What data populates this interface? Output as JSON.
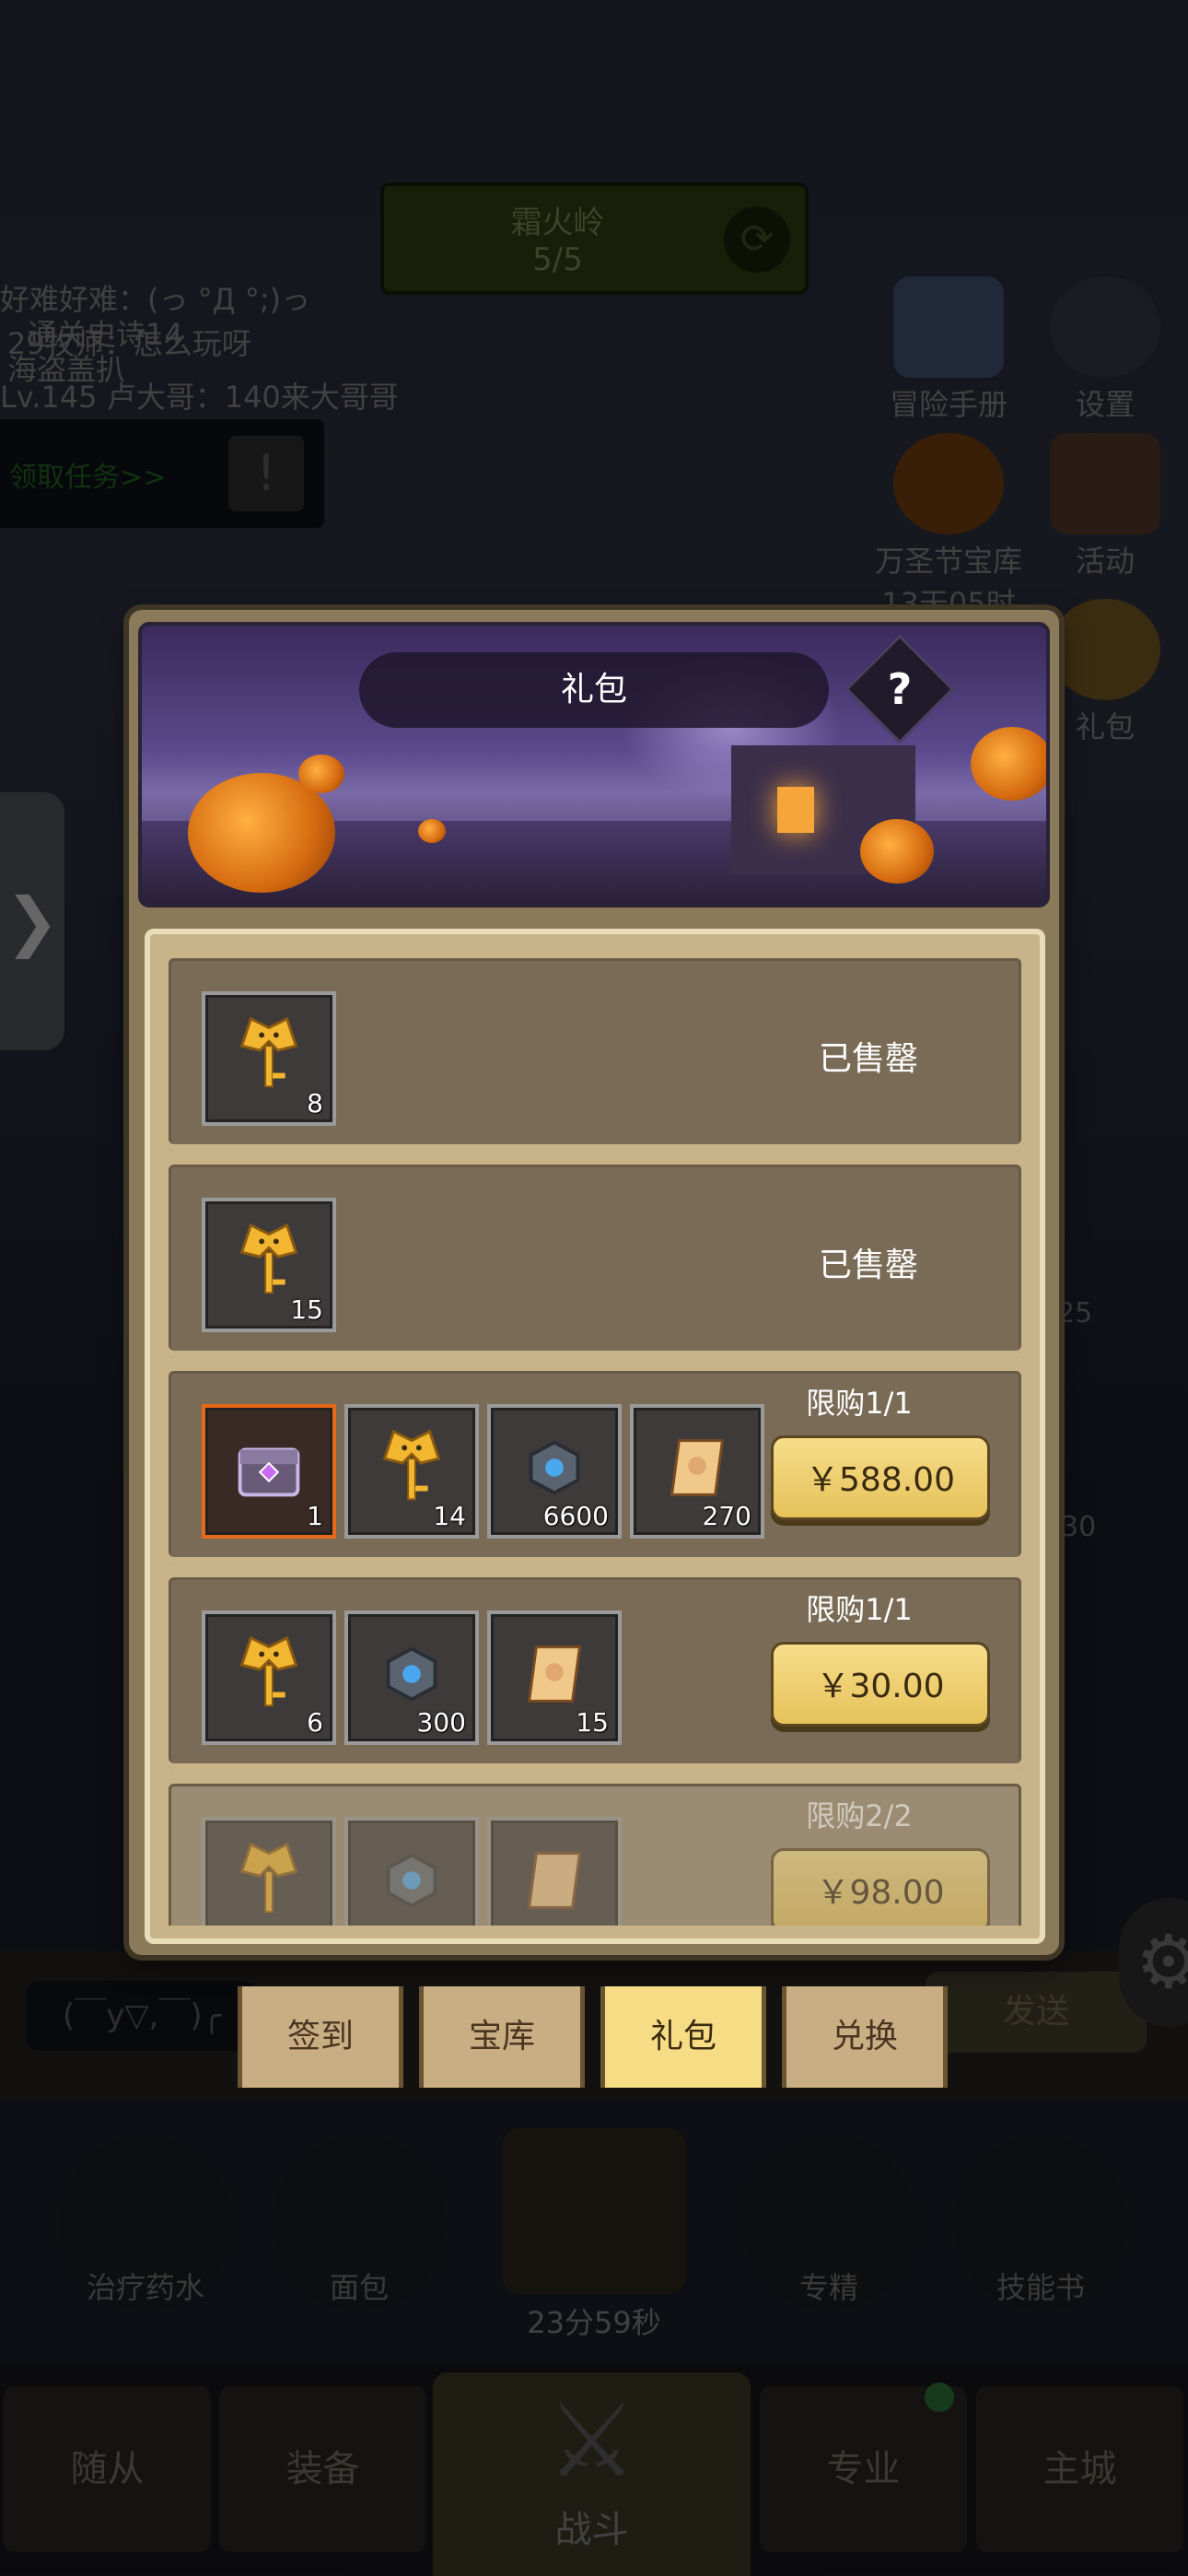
{
  "background": {
    "stage_name": "霜火岭",
    "stage_progress": "5/5",
    "chat_lines": [
      "好难好难：(っ °Д °;)っ",
      "通关史诗14",
      "29牧师：怎么玩呀",
      "海盗盖扒",
      "Lv.145 卢大哥：140来大哥哥"
    ],
    "task_label": "领取任务>>",
    "side_icons": [
      {
        "label": "冒险手册",
        "icon": "book-icon"
      },
      {
        "label": "设置",
        "icon": "gear-icon"
      },
      {
        "label": "万圣节宝库",
        "sub": "13天05时",
        "icon": "pumpkin-icon"
      },
      {
        "label": "活动",
        "icon": "calendar-icon"
      },
      {
        "label": "礼包",
        "icon": "gift-icon"
      }
    ],
    "chat_input": "(￣y▽,￣)╭",
    "send_label": "发送",
    "quick_items": [
      "治疗药水",
      "面包",
      "专精",
      "技能书"
    ],
    "chest_timer": "23分59秒",
    "side_badges": [
      "25",
      "30"
    ],
    "nav": [
      "随从",
      "装备",
      "战斗",
      "专业",
      "主城"
    ]
  },
  "modal": {
    "title": "礼包",
    "help": "?",
    "packs": [
      {
        "items": [
          {
            "icon": "golden-bat-key-icon",
            "count": "8"
          }
        ],
        "status": "已售罄"
      },
      {
        "items": [
          {
            "icon": "golden-bat-key-icon",
            "count": "15"
          }
        ],
        "status": "已售罄"
      },
      {
        "items": [
          {
            "icon": "purple-chest-icon",
            "count": "1"
          },
          {
            "icon": "golden-bat-key-icon",
            "count": "14"
          },
          {
            "icon": "blue-gem-icon",
            "count": "6600"
          },
          {
            "icon": "scroll-icon",
            "count": "270"
          }
        ],
        "limit": "限购1/1",
        "price": "￥588.00"
      },
      {
        "items": [
          {
            "icon": "golden-bat-key-icon",
            "count": "6"
          },
          {
            "icon": "blue-gem-icon",
            "count": "300"
          },
          {
            "icon": "scroll-icon",
            "count": "15"
          }
        ],
        "limit": "限购1/1",
        "price": "￥30.00"
      },
      {
        "items": [
          {
            "icon": "golden-bat-key-icon",
            "count": ""
          },
          {
            "icon": "blue-gem-icon",
            "count": ""
          },
          {
            "icon": "scroll-icon",
            "count": ""
          }
        ],
        "limit": "限购2/2",
        "price": "￥98.00"
      }
    ],
    "tabs": [
      {
        "label": "签到",
        "active": false
      },
      {
        "label": "宝库",
        "active": false
      },
      {
        "label": "礼包",
        "active": true
      },
      {
        "label": "兑换",
        "active": false
      }
    ]
  }
}
